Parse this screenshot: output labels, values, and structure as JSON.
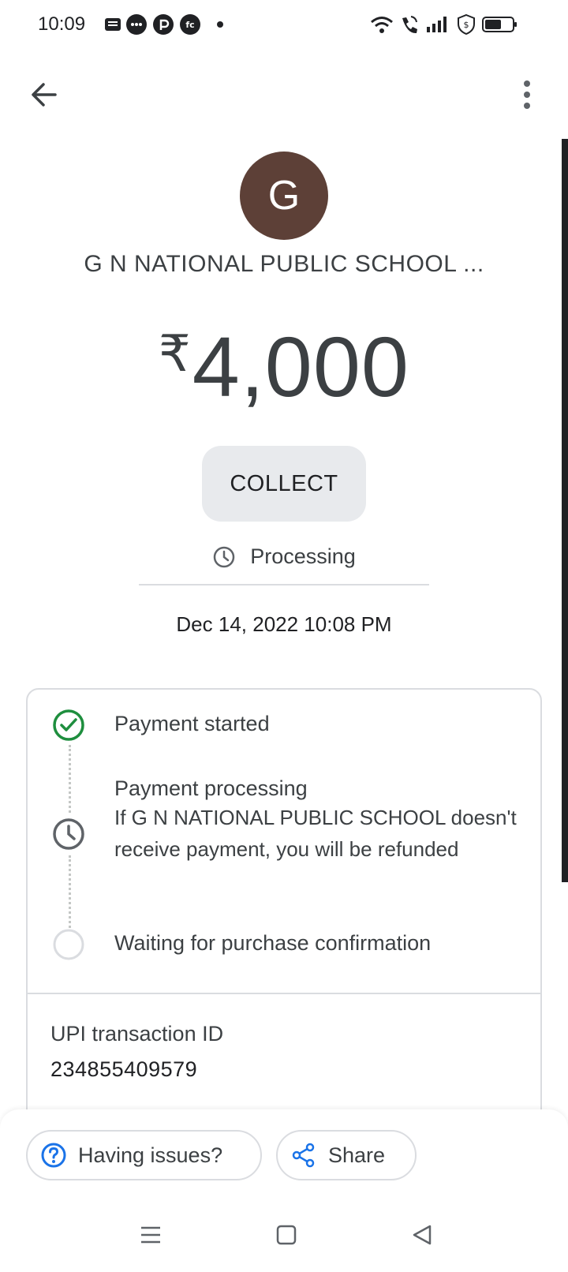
{
  "status_bar": {
    "time": "10:09",
    "notification_icons": [
      "message-icon",
      "chat-icon",
      "p-app-icon",
      "fc-app-icon",
      "dot-icon"
    ],
    "system_icons": [
      "wifi-icon",
      "wifi-call-icon",
      "signal-icon",
      "shield-icon",
      "battery-icon"
    ]
  },
  "app_bar": {
    "back_icon": "arrow-back-icon",
    "menu_icon": "more-vert-icon"
  },
  "payee": {
    "initial": "G",
    "name": "G N NATIONAL PUBLIC SCHOOL ...",
    "avatar_color": "#5d4037"
  },
  "amount": {
    "currency": "₹",
    "value": "4,000"
  },
  "collect_label": "COLLECT",
  "status": {
    "label": "Processing",
    "icon": "clock-icon"
  },
  "datetime": "Dec 14, 2022 10:08 PM",
  "timeline": {
    "steps": [
      {
        "title": "Payment started",
        "icon": "check-circle-icon",
        "color": "#1e8e3e"
      },
      {
        "title": "Payment processing",
        "subtitle": "If G N NATIONAL PUBLIC SCHOOL doesn't receive payment, you will be refunded",
        "icon": "clock-icon"
      },
      {
        "title": "Waiting for purchase confirmation",
        "icon": "empty-circle-icon"
      }
    ]
  },
  "upi": {
    "label": "UPI transaction ID",
    "value": "234855409579"
  },
  "actions": {
    "issues_label": "Having issues?",
    "share_label": "Share",
    "accent_color": "#1a73e8"
  },
  "nav_bar": {
    "icons": [
      "menu-icon",
      "home-square-icon",
      "back-triangle-icon"
    ]
  }
}
